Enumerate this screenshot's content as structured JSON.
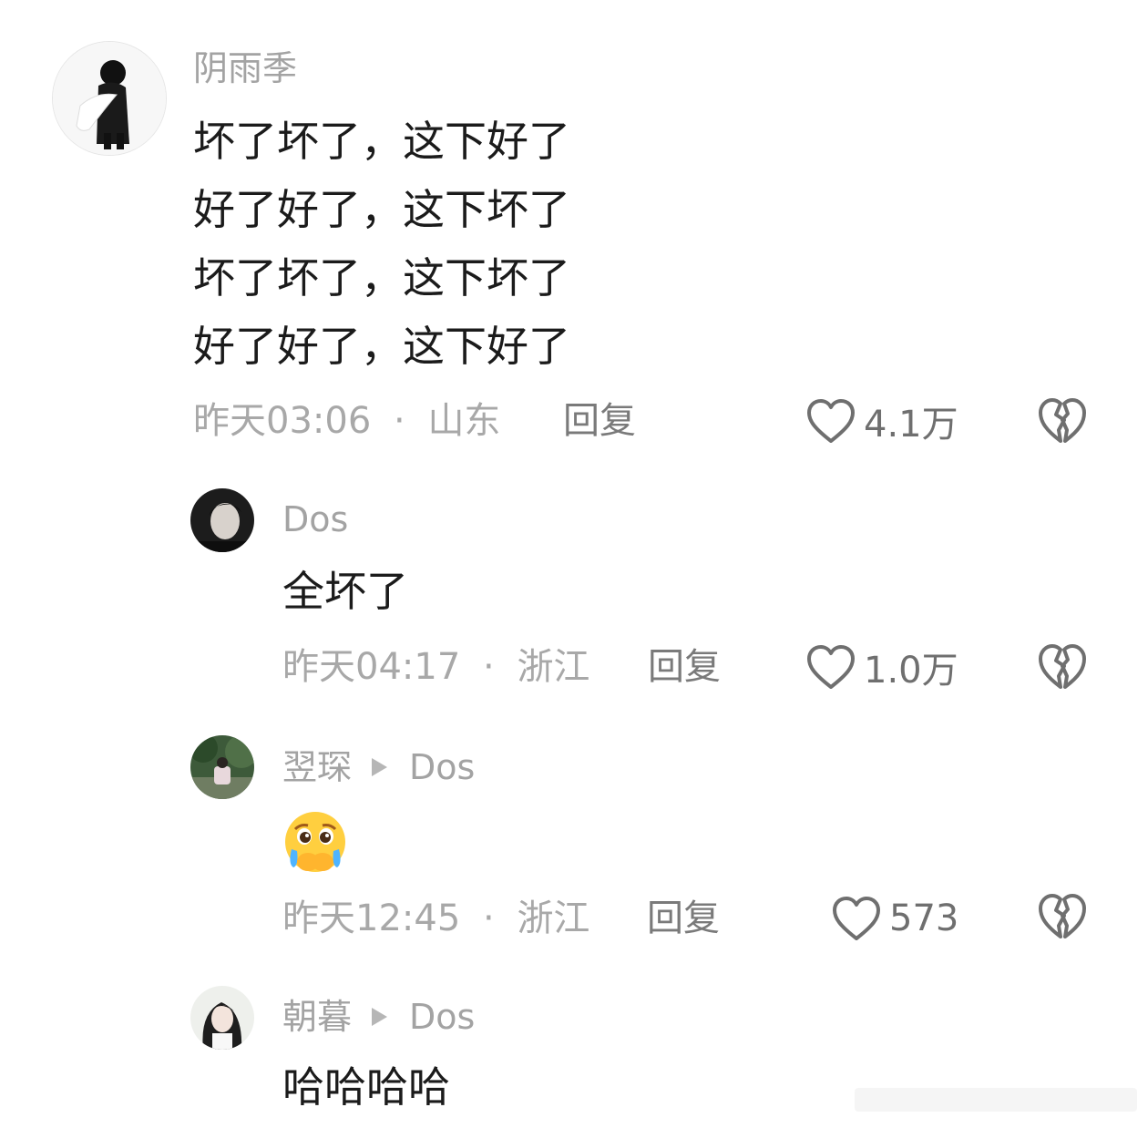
{
  "comments": [
    {
      "author": "阴雨季",
      "lines": [
        "坏了坏了，这下好了",
        "好了好了，这下坏了",
        "坏了坏了，这下坏了",
        "好了好了，这下好了"
      ],
      "time": "昨天03:06",
      "separator": "·",
      "location": "山东",
      "reply": "回复",
      "likes": "4.1万"
    },
    {
      "author": "Dos",
      "lines": [
        "全坏了"
      ],
      "time": "昨天04:17",
      "separator": "·",
      "location": "浙江",
      "reply": "回复",
      "likes": "1.0万"
    },
    {
      "author": "翌琛",
      "reply_to": "Dos",
      "emoji": "crying-face-hands-over-mouth-emoji",
      "time": "昨天12:45",
      "separator": "·",
      "location": "浙江",
      "reply": "回复",
      "likes": "573"
    },
    {
      "author": "朝暮",
      "reply_to": "Dos",
      "lines": [
        "哈哈哈哈"
      ]
    }
  ],
  "icons": {
    "like": "heart-outline-icon",
    "dislike": "broken-heart-icon",
    "reply_arrow": "triangle-right-icon"
  },
  "colors": {
    "author": "#a3a3a3",
    "text": "#1b1b1b",
    "meta": "#a8a8a8",
    "icon": "#6f6f6f"
  }
}
